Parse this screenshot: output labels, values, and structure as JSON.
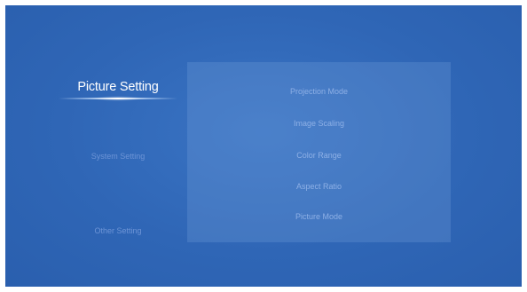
{
  "menu": {
    "items": [
      {
        "label": "Picture Setting",
        "active": true
      },
      {
        "label": "System Setting",
        "active": false
      },
      {
        "label": "Other Setting",
        "active": false
      }
    ]
  },
  "submenu": {
    "items": [
      {
        "label": "Projection Mode"
      },
      {
        "label": "Image Scaling"
      },
      {
        "label": "Color Range"
      },
      {
        "label": "Aspect Ratio"
      },
      {
        "label": "Picture Mode"
      }
    ]
  }
}
